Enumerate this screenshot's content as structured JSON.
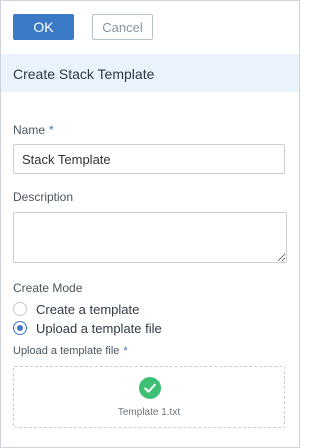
{
  "toolbar": {
    "ok_label": "OK",
    "cancel_label": "Cancel"
  },
  "header": {
    "title": "Create Stack Template"
  },
  "form": {
    "name": {
      "label": "Name",
      "required_mark": "*",
      "value": "Stack Template"
    },
    "description": {
      "label": "Description",
      "value": ""
    },
    "create_mode": {
      "label": "Create Mode",
      "options": [
        {
          "label": "Create a template",
          "selected": false
        },
        {
          "label": "Upload a template file",
          "selected": true
        }
      ]
    },
    "upload": {
      "label": "Upload a template file",
      "required_mark": "*",
      "file_name": "Template 1.txt",
      "status_icon": "check-circle-icon"
    }
  },
  "colors": {
    "primary": "#3b7ac5",
    "header_band": "#eaf3fb",
    "success": "#3fbf73"
  }
}
